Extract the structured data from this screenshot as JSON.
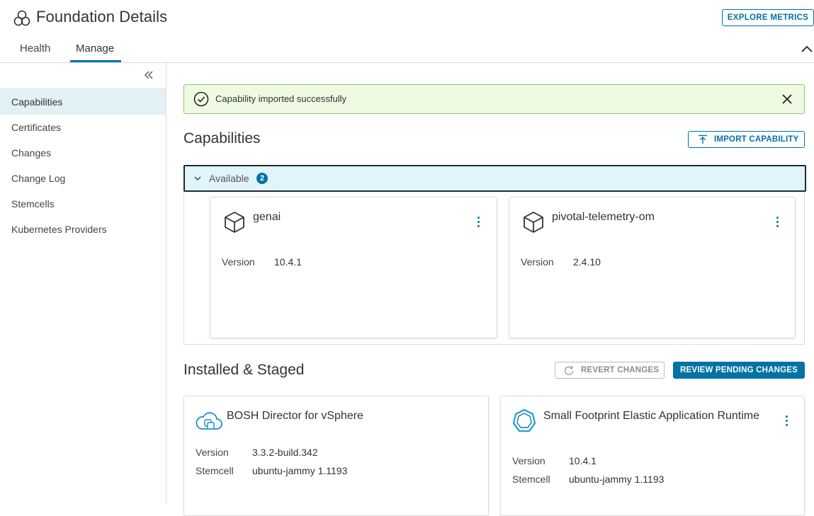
{
  "header": {
    "title": "Foundation Details",
    "explore_label": "EXPLORE METRICS",
    "tabs": [
      {
        "label": "Health"
      },
      {
        "label": "Manage"
      }
    ]
  },
  "sidebar": {
    "items": [
      {
        "label": "Capabilities"
      },
      {
        "label": "Certificates"
      },
      {
        "label": "Changes"
      },
      {
        "label": "Change Log"
      },
      {
        "label": "Stemcells"
      },
      {
        "label": "Kubernetes Providers"
      }
    ]
  },
  "banner": {
    "text": "Capability imported successfully",
    "color": "#eefbe2"
  },
  "capabilities": {
    "title": "Capabilities",
    "import_label": "IMPORT CAPABILITY",
    "group_label": "Available",
    "group_count": "2",
    "cards": [
      {
        "name": "genai",
        "version_label": "Version",
        "version": "10.4.1"
      },
      {
        "name": "pivotal-telemetry-om",
        "version_label": "Version",
        "version": "2.4.10"
      }
    ]
  },
  "installed": {
    "title": "Installed & Staged",
    "revert_label": "REVERT CHANGES",
    "review_label": "REVIEW PENDING CHANGES",
    "cards": [
      {
        "name": "BOSH Director for vSphere",
        "version_label": "Version",
        "version": "3.3.2-build.342",
        "stemcell_label": "Stemcell",
        "stemcell": "ubuntu-jammy 1.1193"
      },
      {
        "name": "Small Footprint Elastic Application Runtime",
        "version_label": "Version",
        "version": "10.4.1",
        "stemcell_label": "Stemcell",
        "stemcell": "ubuntu-jammy 1.1193"
      }
    ]
  },
  "colors": {
    "accent": "#0072a3",
    "active_nav": "#e1f1f6"
  }
}
